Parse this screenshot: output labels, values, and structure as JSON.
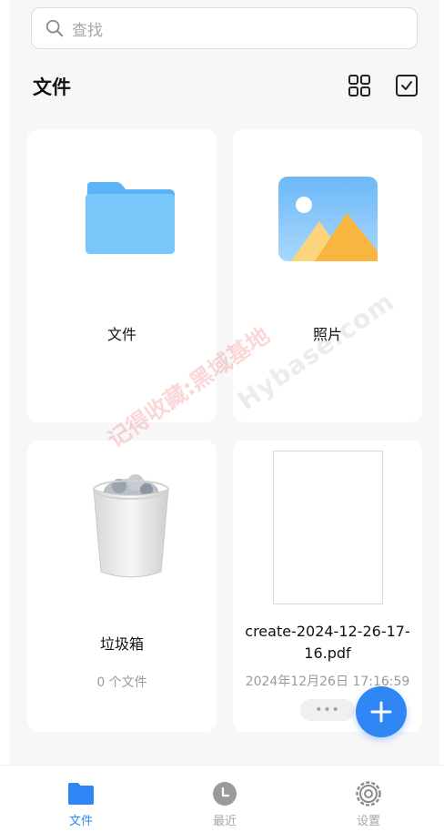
{
  "search": {
    "placeholder": "查找"
  },
  "header": {
    "title": "文件"
  },
  "cards": [
    {
      "label": "文件",
      "icon": "folder-icon"
    },
    {
      "label": "照片",
      "icon": "image-icon"
    },
    {
      "label": "垃圾箱",
      "sub": "0 个文件",
      "icon": "trash-icon"
    },
    {
      "name": "create-2024-12-26-17-16.pdf",
      "date": "2024年12月26日 17:16:59",
      "more": "•••",
      "icon": "pdf-thumbnail"
    }
  ],
  "watermark": {
    "line1": "记得收藏:黑域基地",
    "line2": "Hybase.com"
  },
  "tabbar": {
    "items": [
      {
        "label": "文件",
        "icon": "folder-icon",
        "active": true
      },
      {
        "label": "最近",
        "icon": "clock-icon",
        "active": false
      },
      {
        "label": "设置",
        "icon": "gear-icon",
        "active": false
      }
    ]
  },
  "colors": {
    "accent": "#2f86f4",
    "folder": "#5ab4f5",
    "muted": "#9a9a9a"
  }
}
